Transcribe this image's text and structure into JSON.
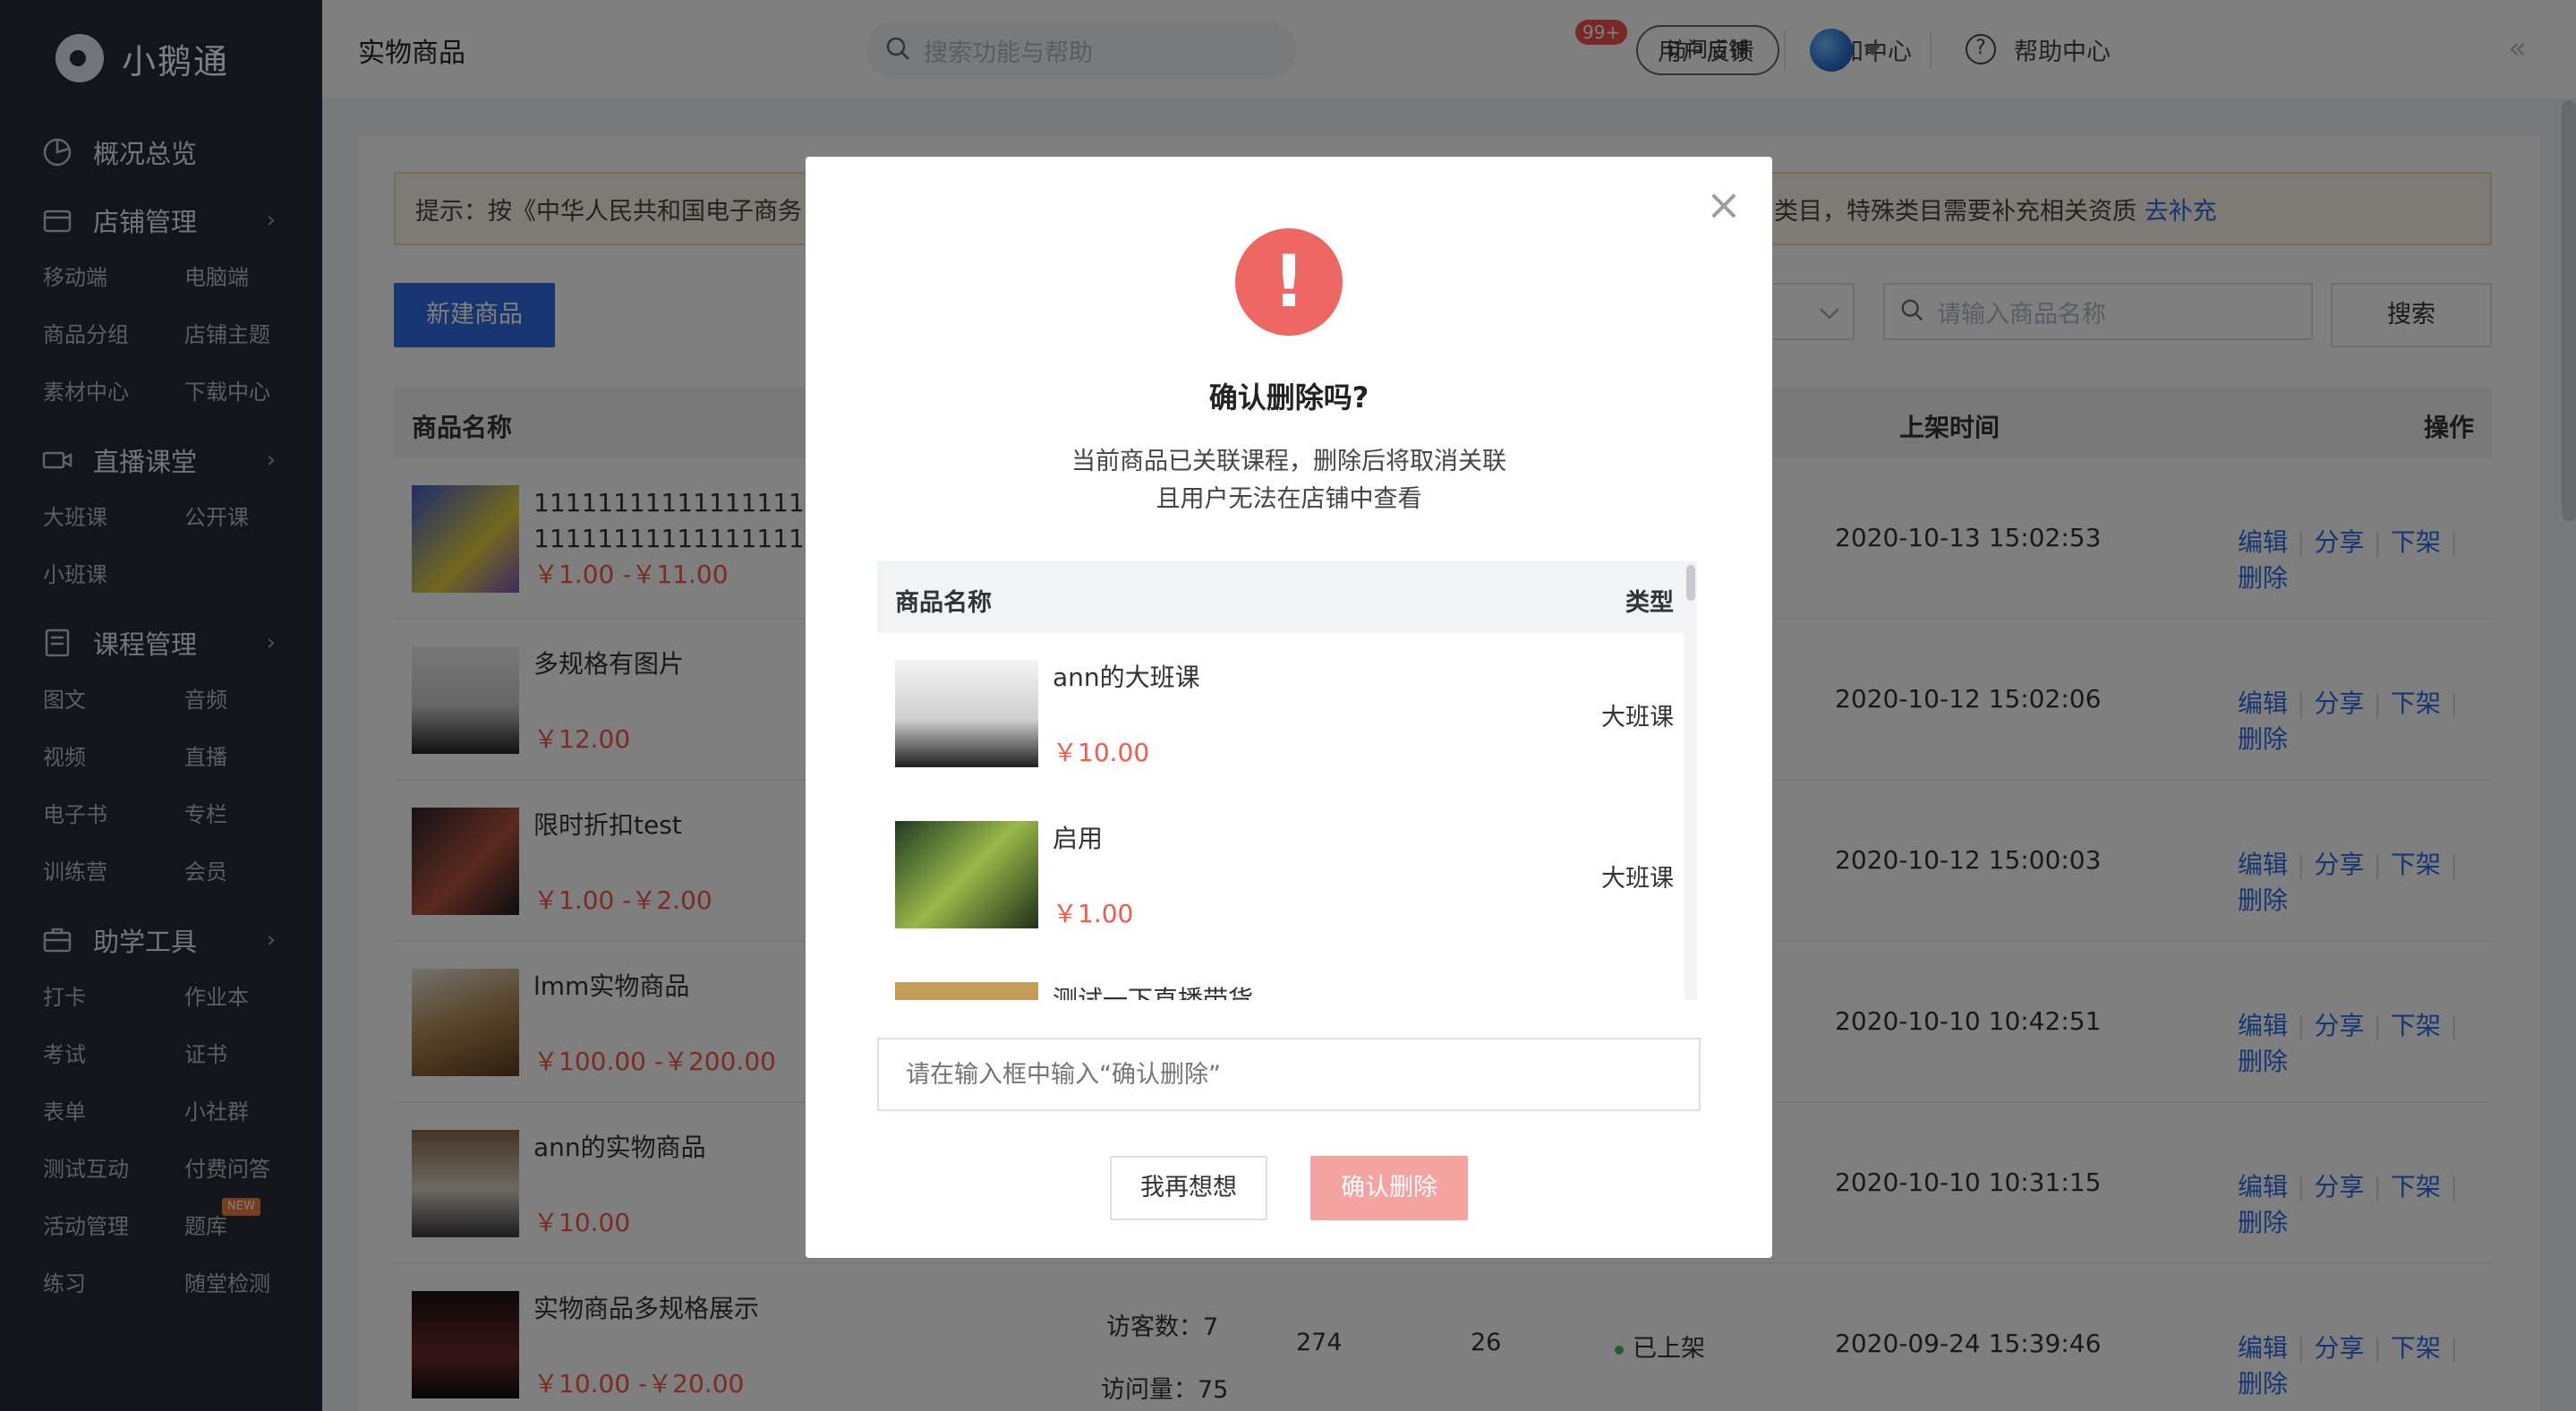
{
  "app": {
    "name": "小鹅通"
  },
  "sidebar": {
    "overview": "概况总览",
    "groups": [
      {
        "title": "店铺管理",
        "items": [
          "移动端",
          "电脑端",
          "商品分组",
          "店铺主题",
          "素材中心",
          "下载中心"
        ]
      },
      {
        "title": "直播课堂",
        "items": [
          "大班课",
          "公开课",
          "小班课"
        ]
      },
      {
        "title": "课程管理",
        "items": [
          "图文",
          "音频",
          "视频",
          "直播",
          "电子书",
          "专栏",
          "训练营",
          "会员"
        ]
      },
      {
        "title": "助学工具",
        "items": [
          "打卡",
          "作业本",
          "考试",
          "证书",
          "表单",
          "小社群",
          "测试互动",
          "付费问答",
          "活动管理",
          "题库",
          "练习",
          "随堂检测"
        ]
      }
    ],
    "new_badge": "NEW"
  },
  "header": {
    "title": "实物商品",
    "search_placeholder": "搜索功能与帮助",
    "feedback": "用户反馈",
    "notify": "通知中心",
    "notify_badge": "99+",
    "visit_store": "访问店铺",
    "help": "帮助中心"
  },
  "main": {
    "notice_text": "提示：按《中华人民共和国电子商务",
    "notice_tail": "类目，特殊类目需要补充相关资质",
    "notice_link": "去补充",
    "new_button": "新建商品",
    "goods_search_placeholder": "请输入商品名称",
    "search_button": "搜索",
    "columns": {
      "name": "商品名称",
      "time": "上架时间",
      "op": "操作"
    },
    "ops": [
      "编辑",
      "分享",
      "下架",
      "删除"
    ],
    "rows": [
      {
        "name": "11111111111111111111111111111111111111111111",
        "price": "￥1.00 -￥11.00",
        "time": "2020-10-13 15:02:53"
      },
      {
        "name": "多规格有图片",
        "price": "￥12.00",
        "time": "2020-10-12 15:02:06"
      },
      {
        "name": "限时折扣test",
        "price": "￥1.00 -￥2.00",
        "time": "2020-10-12 15:00:03"
      },
      {
        "name": "lmm实物商品",
        "price": "￥100.00 -￥200.00",
        "time": "2020-10-10 10:42:51"
      },
      {
        "name": "ann的实物商品",
        "price": "￥10.00",
        "time": "2020-10-10 10:31:15"
      },
      {
        "name": "实物商品多规格展示",
        "price": "￥10.00 -￥20.00",
        "time": "2020-09-24 15:39:46",
        "visitors": "访客数：7",
        "views": "访问量：75",
        "col_a": "274",
        "col_b": "26",
        "status": "已上架"
      }
    ]
  },
  "modal": {
    "title": "确认删除吗?",
    "desc_line1": "当前商品已关联课程，删除后将取消关联",
    "desc_line2": "且用户无法在店铺中查看",
    "col_name": "商品名称",
    "col_type": "类型",
    "items": [
      {
        "name": "ann的大班课",
        "price": "￥10.00",
        "type": "大班课"
      },
      {
        "name": "启用",
        "price": "￥1.00",
        "type": "大班课"
      },
      {
        "name": "测试一下直播带货",
        "price": "",
        "type": ""
      }
    ],
    "input_placeholder": "请在输入框中输入“确认删除”",
    "cancel": "我再想想",
    "confirm": "确认删除"
  },
  "colors": {
    "accent": "#2f6be0",
    "danger": "#ef6762",
    "price": "#f25a4a",
    "sidebar": "#242a37"
  }
}
